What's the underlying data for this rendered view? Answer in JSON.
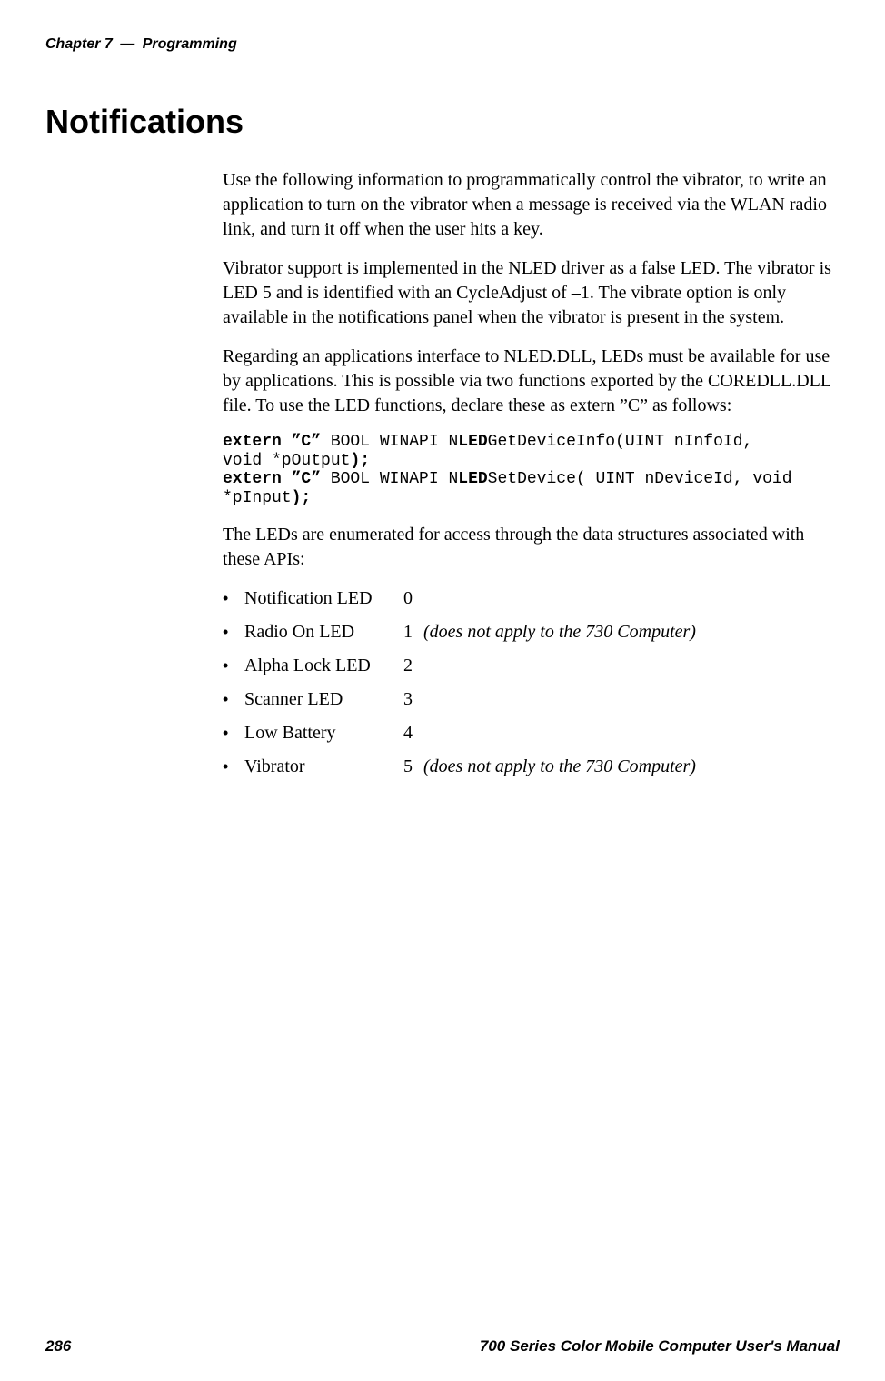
{
  "header": {
    "chapter": "Chapter 7",
    "dash": "—",
    "section": "Programming"
  },
  "title": "Notifications",
  "paragraphs": {
    "p1": "Use the following information to programmatically control the vibrator, to write an application to turn on the vibrator when a message is received via the WLAN radio link, and turn it off when the user hits a key.",
    "p2": "Vibrator support is implemented in the NLED driver as a false LED. The vibrator is LED 5 and is identified with an CycleAdjust of –1. The vibrate option is only available in the notifications panel when the vibrator is pres­ent in the system.",
    "p3": "Regarding an applications interface to NLED.DLL, LEDs must be avail­able for use by applications. This is possible via two functions exported by the COREDLL.DLL file. To use the LED functions, declare these as ex­tern ”C” as follows:",
    "p4": "The LEDs are enumerated for access through the data structures associated with these APIs:"
  },
  "code": {
    "l1a": "extern ”C”",
    "l1b": " BOOL WINAPI N",
    "l1c": "LED",
    "l1d": "GetDeviceInfo(UINT nInfoId,",
    "l2a": "void *pOutput",
    "l2b": ");",
    "l3a": "extern ”C”",
    "l3b": " BOOL WINAPI N",
    "l3c": "LED",
    "l3d": "SetDevice( UINT nDeviceId, void",
    "l4a": "*pInput",
    "l4b": ");"
  },
  "leds": [
    {
      "name": "Notification LED",
      "num": "0",
      "note": ""
    },
    {
      "name": "Radio On LED",
      "num": "1",
      "note": "(does not apply to the 730 Computer)"
    },
    {
      "name": "Alpha Lock LED",
      "num": "2",
      "note": ""
    },
    {
      "name": "Scanner LED",
      "num": "3",
      "note": ""
    },
    {
      "name": "Low Battery",
      "num": "4",
      "note": ""
    },
    {
      "name": "Vibrator",
      "num": "5",
      "note": "(does not apply to the 730 Computer)"
    }
  ],
  "footer": {
    "pagenum": "286",
    "manual": "700 Series Color Mobile Computer User's Manual"
  },
  "bullet": "•"
}
